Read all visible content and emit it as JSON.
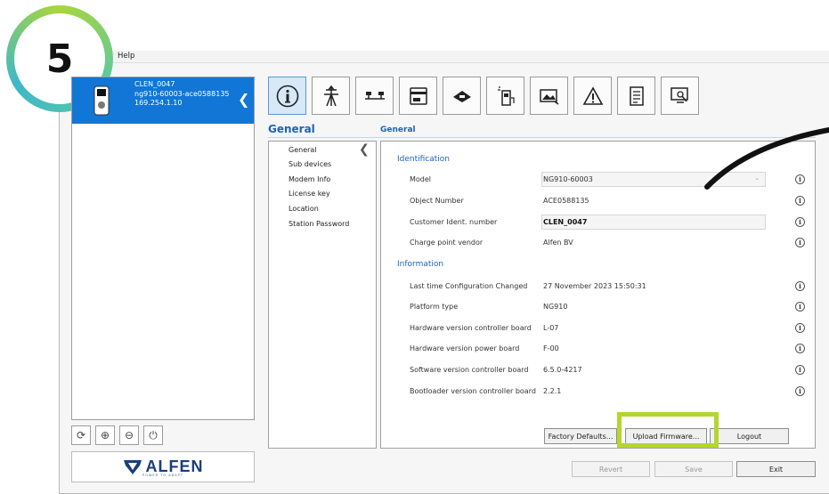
{
  "step": {
    "number": "5"
  },
  "menu": {
    "help": "Help"
  },
  "device": {
    "name": "CLEN_0047",
    "id": "ng910-60003-ace0588135",
    "ip": "169.254.1.10"
  },
  "brand": {
    "name": "ALFEN",
    "tagline": "POWER TO ADAPT"
  },
  "section": {
    "title": "General",
    "content_title": "General"
  },
  "nav": [
    {
      "label": "General"
    },
    {
      "label": "Sub devices"
    },
    {
      "label": "Modem Info"
    },
    {
      "label": "License key"
    },
    {
      "label": "Location"
    },
    {
      "label": "Station Password"
    }
  ],
  "identification": {
    "heading": "Identification",
    "rows": [
      {
        "label": "Model",
        "value": "NG910-60003"
      },
      {
        "label": "Object Number",
        "value": "ACE0588135"
      },
      {
        "label": "Customer Ident. number",
        "value": "CLEN_0047"
      },
      {
        "label": "Charge point vendor",
        "value": "Alfen BV"
      }
    ]
  },
  "information": {
    "heading": "Information",
    "rows": [
      {
        "label": "Last time Configuration Changed",
        "value": "27 November 2023 15:50:31"
      },
      {
        "label": "Platform type",
        "value": "NG910"
      },
      {
        "label": "Hardware version controller board",
        "value": "L-07"
      },
      {
        "label": "Hardware version power board",
        "value": "F-00"
      },
      {
        "label": "Software version controller board",
        "value": "6.5.0-4217"
      },
      {
        "label": "Bootloader version controller board",
        "value": "2.2.1"
      }
    ]
  },
  "buttons": {
    "factory_defaults": "Factory Defaults...",
    "upload_firmware": "Upload Firmware...",
    "logout": "Logout",
    "revert": "Revert",
    "save": "Save",
    "exit": "Exit"
  },
  "colors": {
    "accent": "#1176d6",
    "heading": "#1c64b6",
    "highlight": "#b4d62e"
  }
}
